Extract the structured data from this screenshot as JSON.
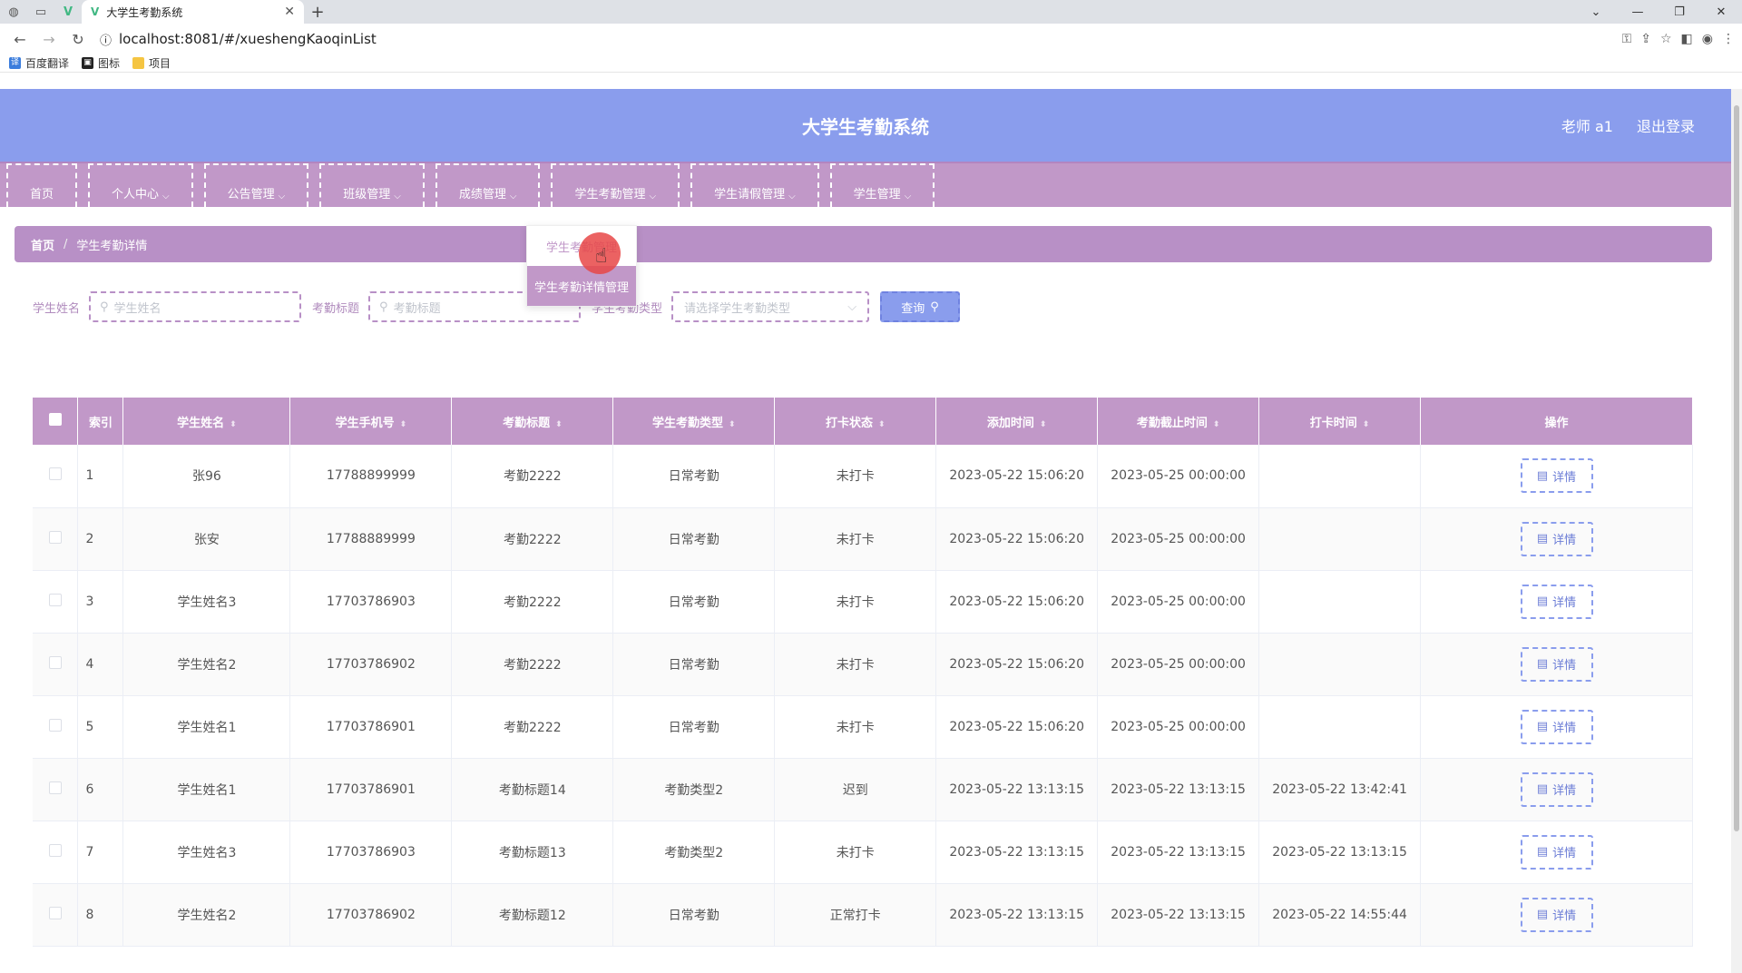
{
  "browser": {
    "tab_title": "大学生考勤系统",
    "url": "localhost:8081/#/xueshengKaoqinList",
    "bookmarks": [
      "百度翻译",
      "图标",
      "项目"
    ]
  },
  "header": {
    "title": "大学生考勤系统",
    "user": "老师 a1",
    "logout": "退出登录"
  },
  "nav": {
    "items": [
      {
        "label": "首页",
        "dropdown": false
      },
      {
        "label": "个人中心",
        "dropdown": true
      },
      {
        "label": "公告管理",
        "dropdown": true
      },
      {
        "label": "班级管理",
        "dropdown": true
      },
      {
        "label": "成绩管理",
        "dropdown": true
      },
      {
        "label": "学生考勤管理",
        "dropdown": true
      },
      {
        "label": "学生请假管理",
        "dropdown": true
      },
      {
        "label": "学生管理",
        "dropdown": true
      }
    ],
    "dropdown_items": [
      "学生考勤管理",
      "学生考勤详情管理"
    ]
  },
  "breadcrumb": {
    "home": "首页",
    "separator": "/",
    "current": "学生考勤详情"
  },
  "search": {
    "name_label": "学生姓名",
    "name_placeholder": "学生姓名",
    "title_label": "考勤标题",
    "title_placeholder": "考勤标题",
    "type_label": "学生考勤类型",
    "type_placeholder": "请选择学生考勤类型",
    "query_button": "查询"
  },
  "table": {
    "headers": [
      "索引",
      "学生姓名",
      "学生手机号",
      "考勤标题",
      "学生考勤类型",
      "打卡状态",
      "添加时间",
      "考勤截止时间",
      "打卡时间",
      "操作"
    ],
    "detail_label": "详情",
    "rows": [
      {
        "index": "1",
        "name": "张96",
        "phone": "17788899999",
        "title": "考勤2222",
        "type": "日常考勤",
        "status": "未打卡",
        "added": "2023-05-22 15:06:20",
        "deadline": "2023-05-25 00:00:00",
        "punch": ""
      },
      {
        "index": "2",
        "name": "张安",
        "phone": "17788889999",
        "title": "考勤2222",
        "type": "日常考勤",
        "status": "未打卡",
        "added": "2023-05-22 15:06:20",
        "deadline": "2023-05-25 00:00:00",
        "punch": ""
      },
      {
        "index": "3",
        "name": "学生姓名3",
        "phone": "17703786903",
        "title": "考勤2222",
        "type": "日常考勤",
        "status": "未打卡",
        "added": "2023-05-22 15:06:20",
        "deadline": "2023-05-25 00:00:00",
        "punch": ""
      },
      {
        "index": "4",
        "name": "学生姓名2",
        "phone": "17703786902",
        "title": "考勤2222",
        "type": "日常考勤",
        "status": "未打卡",
        "added": "2023-05-22 15:06:20",
        "deadline": "2023-05-25 00:00:00",
        "punch": ""
      },
      {
        "index": "5",
        "name": "学生姓名1",
        "phone": "17703786901",
        "title": "考勤2222",
        "type": "日常考勤",
        "status": "未打卡",
        "added": "2023-05-22 15:06:20",
        "deadline": "2023-05-25 00:00:00",
        "punch": ""
      },
      {
        "index": "6",
        "name": "学生姓名1",
        "phone": "17703786901",
        "title": "考勤标题14",
        "type": "考勤类型2",
        "status": "迟到",
        "added": "2023-05-22 13:13:15",
        "deadline": "2023-05-22 13:13:15",
        "punch": "2023-05-22 13:42:41"
      },
      {
        "index": "7",
        "name": "学生姓名3",
        "phone": "17703786903",
        "title": "考勤标题13",
        "type": "考勤类型2",
        "status": "未打卡",
        "added": "2023-05-22 13:13:15",
        "deadline": "2023-05-22 13:13:15",
        "punch": "2023-05-22 13:13:15"
      },
      {
        "index": "8",
        "name": "学生姓名2",
        "phone": "17703786902",
        "title": "考勤标题12",
        "type": "日常考勤",
        "status": "正常打卡",
        "added": "2023-05-22 13:13:15",
        "deadline": "2023-05-22 13:13:15",
        "punch": "2023-05-22 14:55:44"
      }
    ]
  }
}
